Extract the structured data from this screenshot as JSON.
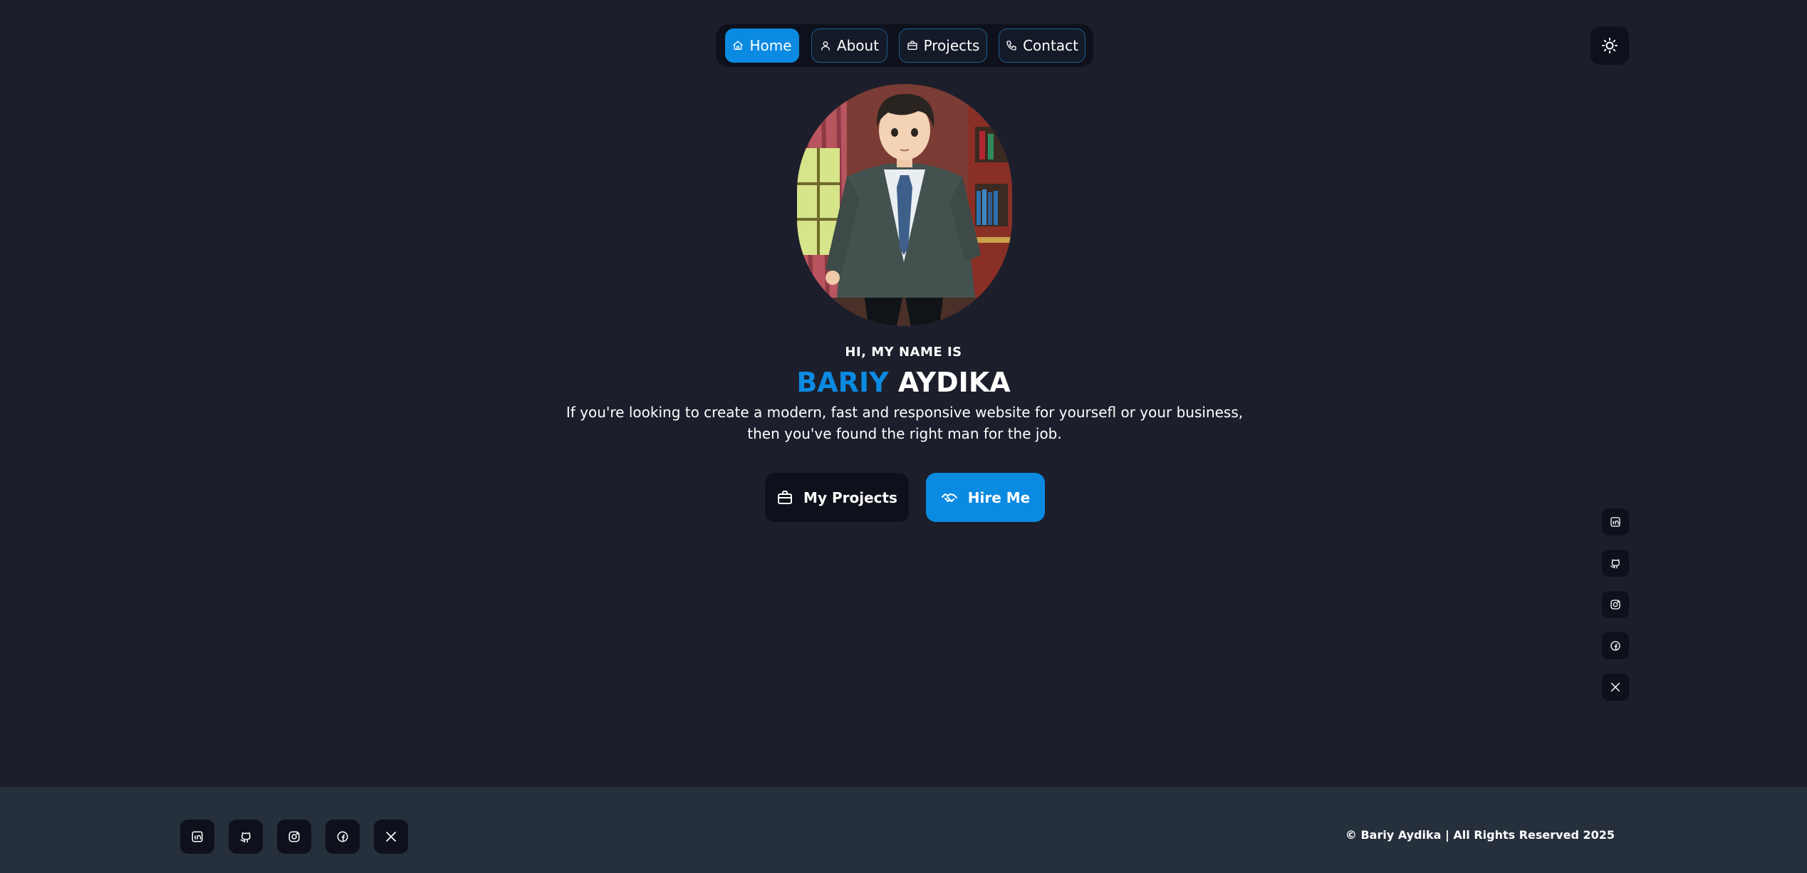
{
  "nav": {
    "items": [
      {
        "label": "Home",
        "icon": "home-icon",
        "active": true
      },
      {
        "label": "About",
        "icon": "user-icon",
        "active": false
      },
      {
        "label": "Projects",
        "icon": "briefcase-icon",
        "active": false
      },
      {
        "label": "Contact",
        "icon": "phone-icon",
        "active": false
      }
    ]
  },
  "theme_toggle": {
    "icon": "sun-icon"
  },
  "hero": {
    "greeting": "HI, MY NAME IS",
    "first_name": "BARIY",
    "last_name": "AYDIKA",
    "tagline": "If you're looking to create a modern, fast and responsive website for yoursefl or your business, then you've found the right man for the job."
  },
  "cta": {
    "projects_label": "My Projects",
    "hire_label": "Hire Me"
  },
  "social": [
    "linkedin-icon",
    "github-icon",
    "instagram-icon",
    "facebook-icon",
    "x-icon"
  ],
  "footer": {
    "copyright": "© Bariy Aydika | All Rights Reserved 2025"
  },
  "colors": {
    "background": "#1c1f2b",
    "accent": "#0b8ae2",
    "panel": "#0e111b",
    "footer": "#262f3c"
  }
}
